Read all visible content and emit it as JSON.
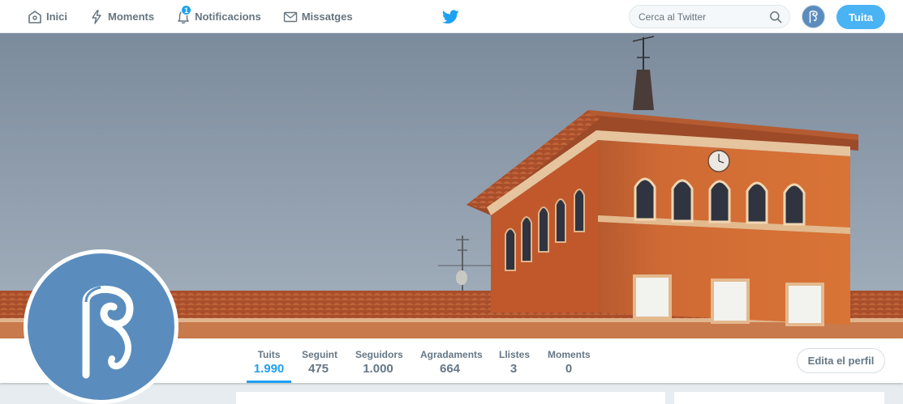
{
  "nav": {
    "home_label": "Inici",
    "moments_label": "Moments",
    "notifications_label": "Notificacions",
    "notifications_count": "1",
    "messages_label": "Missatges"
  },
  "search": {
    "placeholder": "Cerca al Twitter"
  },
  "tweet_button": "Tuita",
  "stats": [
    {
      "label": "Tuits",
      "value": "1.990"
    },
    {
      "label": "Seguint",
      "value": "475"
    },
    {
      "label": "Seguidors",
      "value": "1.000"
    },
    {
      "label": "Agradaments",
      "value": "664"
    },
    {
      "label": "Llistes",
      "value": "3"
    },
    {
      "label": "Moments",
      "value": "0"
    }
  ],
  "edit_profile_button": "Edita el perfil",
  "colors": {
    "accent": "#1da1f2",
    "tweet_button": "#4ab3f4",
    "avatar_bg": "#5a8dbe"
  },
  "icons": {
    "home": "home-icon",
    "moments": "lightning-icon",
    "notifications": "bell-icon",
    "messages": "envelope-icon",
    "brand": "twitter-bird-icon",
    "search": "magnifier-icon"
  }
}
